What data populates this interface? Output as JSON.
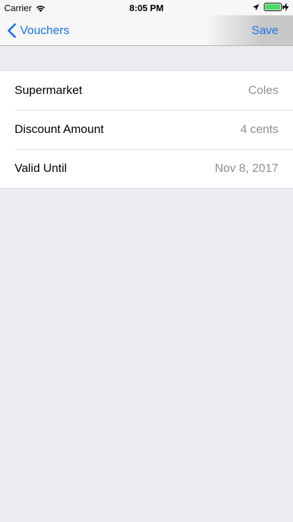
{
  "status_bar": {
    "carrier": "Carrier",
    "time": "8:05 PM",
    "battery_level": 1.0,
    "battery_color": "#4cd964"
  },
  "nav_bar": {
    "back_label": "Vouchers",
    "save_label": "Save",
    "accent_color": "#1a73e8"
  },
  "rows": [
    {
      "label": "Supermarket",
      "value": "Coles"
    },
    {
      "label": "Discount Amount",
      "value": "4 cents"
    },
    {
      "label": "Valid Until",
      "value": "Nov 8, 2017"
    }
  ]
}
